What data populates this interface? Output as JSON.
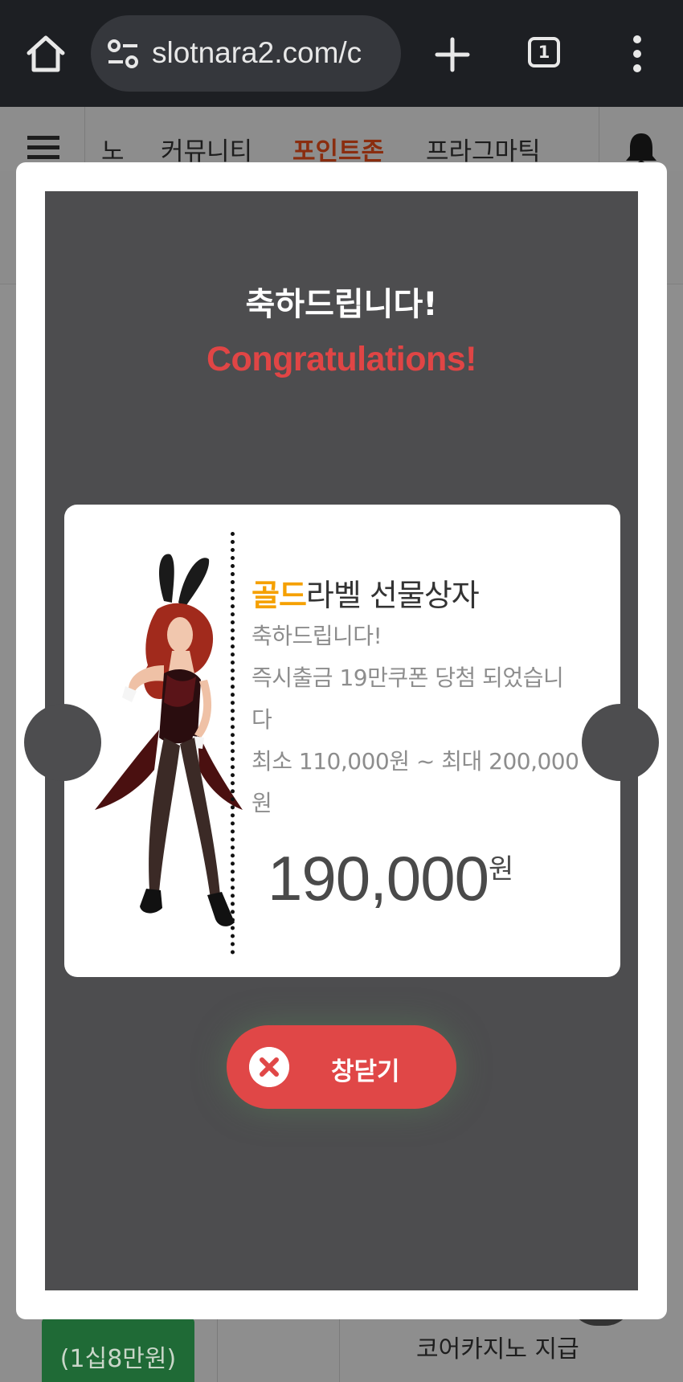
{
  "browser": {
    "url": "slotnara2.com/c",
    "tab_count": "1"
  },
  "site_nav": {
    "items": [
      "노",
      "커뮤니티",
      "포인트존",
      "프라그마틱"
    ],
    "active_index": 2
  },
  "background_page": {
    "green_button_label": "(1십8만원)",
    "right_column_text": "코어카지노 지급"
  },
  "modal": {
    "heading_ko": "축하드립니다!",
    "heading_en": "Congratulations!",
    "ticket": {
      "title_highlight": "골드",
      "title_rest": "라벨 선물상자",
      "desc_line1": "축하드립니다!",
      "desc_line2": "즉시출금 19만쿠폰 당첨 되었습니",
      "desc_line3": "다",
      "desc_line4": "최소 110,000원 ~ 최대 200,000",
      "desc_line5": "원",
      "amount": "190,000",
      "amount_unit": "원"
    },
    "close_label": "창닫기"
  },
  "colors": {
    "panel_bg": "#4d4d4f",
    "accent_red": "#e04747",
    "gold": "#f5a000"
  }
}
